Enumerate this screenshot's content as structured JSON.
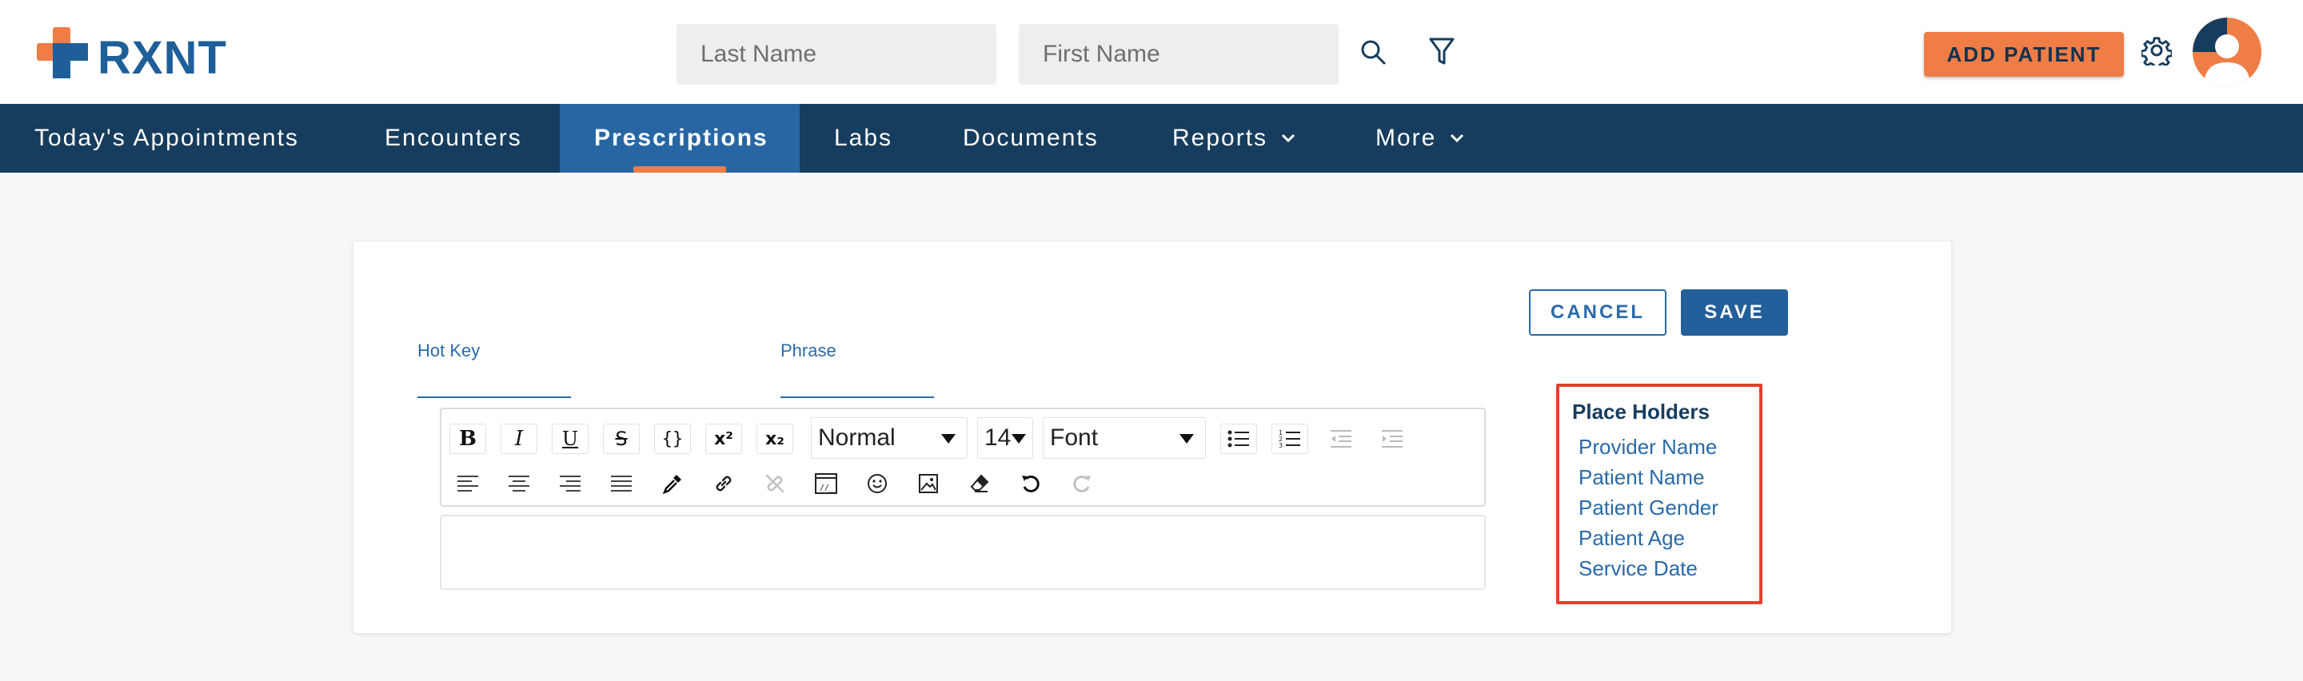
{
  "app": {
    "logo_text": "RXNT"
  },
  "search": {
    "last_name_placeholder": "Last Name",
    "first_name_placeholder": "First Name"
  },
  "header": {
    "add_patient_label": "ADD PATIENT",
    "icons": [
      "search-icon",
      "filter-icon",
      "gear-icon",
      "avatar"
    ]
  },
  "nav": {
    "items": [
      {
        "label": "Today's Appointments"
      },
      {
        "label": "Encounters"
      },
      {
        "label": "Prescriptions",
        "active": true
      },
      {
        "label": "Labs"
      },
      {
        "label": "Documents"
      },
      {
        "label": "Reports",
        "has_dropdown": true
      },
      {
        "label": "More",
        "has_dropdown": true
      }
    ]
  },
  "form": {
    "hot_key_label": "Hot Key",
    "hot_key_value": "",
    "phrase_label": "Phrase",
    "phrase_value": "",
    "cancel_label": "CANCEL",
    "save_label": "SAVE"
  },
  "editor": {
    "format_value": "Normal",
    "size_value": "14",
    "font_value": "Font",
    "content": "",
    "toolbar_icons": [
      "bold-icon",
      "italic-icon",
      "underline-icon",
      "strikethrough-icon",
      "code-block-icon",
      "superscript-icon",
      "subscript-icon",
      "bullet-list-icon",
      "numbered-list-icon",
      "outdent-icon",
      "indent-icon",
      "align-left-icon",
      "align-center-icon",
      "align-right-icon",
      "align-justify-icon",
      "color-picker-icon",
      "link-icon",
      "unlink-icon",
      "source-code-icon",
      "emoji-icon",
      "image-icon",
      "clear-formatting-icon",
      "undo-icon",
      "redo-icon"
    ]
  },
  "placeholders": {
    "title": "Place Holders",
    "items": [
      "Provider Name",
      "Patient Name",
      "Patient Gender",
      "Patient Age",
      "Service Date"
    ]
  },
  "colors": {
    "brand_blue": "#1f5f99",
    "nav_bg": "#173d5e",
    "nav_active": "#2766a3",
    "accent_orange": "#ef7d45",
    "highlight_red": "#e0412c"
  }
}
